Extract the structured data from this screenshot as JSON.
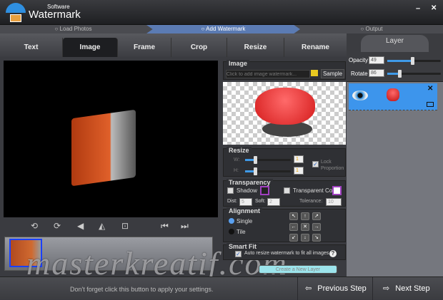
{
  "app": {
    "title_main": "Watermark",
    "title_sub": "Software",
    "minimize": "–",
    "close": "✕"
  },
  "steps": [
    {
      "label": "○ Load Photos"
    },
    {
      "label": "○ Add Watermark"
    },
    {
      "label": "○ Output"
    }
  ],
  "tabs": [
    {
      "label": "Text"
    },
    {
      "label": "Image"
    },
    {
      "label": "Frame"
    },
    {
      "label": "Crop"
    },
    {
      "label": "Resize"
    },
    {
      "label": "Rename"
    }
  ],
  "image_group": {
    "title": "Image",
    "placeholder": "Click to add image watermark...",
    "sample": "Sample"
  },
  "resize": {
    "title": "Resize",
    "w_label": "W:",
    "h_label": "H:",
    "w_value": "1",
    "h_value": "1",
    "lock": "Lock Proportion",
    "lock_checked": true
  },
  "transparency": {
    "title": "Transparency",
    "shadow": "Shadow",
    "transparent_color": "Transparent Color",
    "dist_label": "Dist:",
    "dist": "5",
    "soft_label": "Soft:",
    "soft": "2",
    "tolerance_label": "Tolerance:",
    "tolerance": "10"
  },
  "alignment": {
    "title": "Alignment",
    "single": "Single",
    "tile": "Tile",
    "selected": "Single",
    "arrows": [
      "↖",
      "↑",
      "↗",
      "←",
      "✕",
      "→",
      "↙",
      "↓",
      "↘"
    ]
  },
  "smart_fit": {
    "title": "Smart Fit",
    "label": "Auto resize watermark to fit all images.",
    "checked": true,
    "help": "?"
  },
  "apply_button": "Create a New Layer",
  "layer": {
    "title": "Layer",
    "opacity_label": "Opacity",
    "opacity": "49",
    "rotate_label": "Rotate",
    "rotate": "86",
    "close": "✕"
  },
  "tools": [
    "⟲",
    "⟳",
    "◀",
    "◭",
    "⊡",
    "⏮",
    "⏭"
  ],
  "bottom": {
    "hint": "Don't forget click this button to apply your settings.",
    "prev": "Previous Step",
    "next": "Next Step"
  },
  "watermark_overlay": "masterkreatif.com",
  "colors": {
    "accent": "#3f9ae8",
    "step_active": "#5b7bb3",
    "layer_selected": "#3d95ec"
  }
}
